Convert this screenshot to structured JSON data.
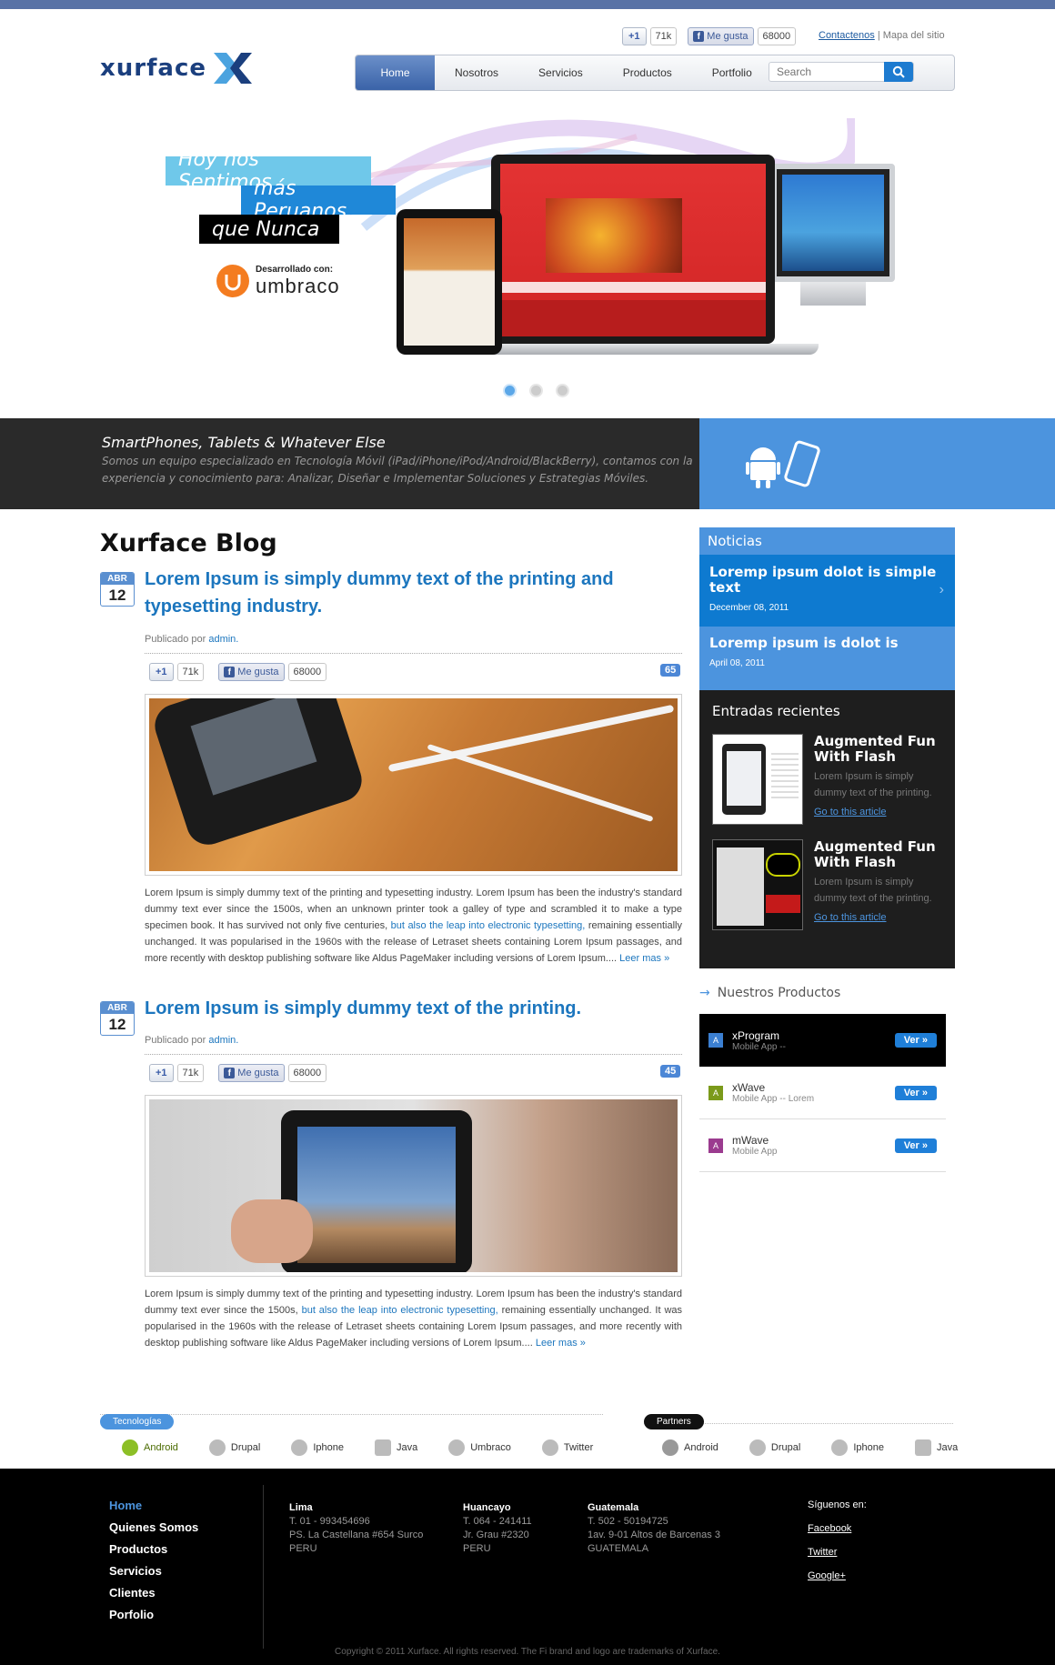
{
  "header": {
    "logo_text": "xurface",
    "gplus_label": "+1",
    "gplus_count": "71k",
    "fb_label": "Me gusta",
    "fb_count": "68000",
    "contact_link": "Contactenos",
    "sitemap_link": "Mapa del sitio",
    "search_placeholder": "Search"
  },
  "nav": {
    "items": [
      {
        "label": "Home"
      },
      {
        "label": "Nosotros"
      },
      {
        "label": "Servicios"
      },
      {
        "label": "Productos"
      },
      {
        "label": "Portfolio"
      }
    ]
  },
  "hero": {
    "line1": "Hoy nos Sentimos",
    "line2": "más Peruanos",
    "line3": "que Nunca",
    "dev_label": "Desarrollado con:",
    "dev_brand": "umbraco",
    "slides_total": 3,
    "slide_active": 1
  },
  "band": {
    "title": "SmartPhones, Tablets  & Whatever Else",
    "text": "Somos un equipo especializado en Tecnología Móvil (iPad/iPhone/iPod/Android/BlackBerry),  contamos con la experiencia y conocimiento para: Analizar, Diseñar e Implementar Soluciones y Estrategias Móviles."
  },
  "blog": {
    "title": "Xurface Blog",
    "posts": [
      {
        "month": "ABR",
        "day": "12",
        "title": "Lorem Ipsum is simply dummy text of the printing and typesetting industry.",
        "byline": "Publicado por",
        "author": "admin.",
        "gplus": "+1",
        "gcount": "71k",
        "fb": "Me gusta",
        "fbcount": "68000",
        "comments": "65",
        "p1": "Lorem Ipsum is simply dummy text of the printing and typesetting industry. Lorem Ipsum has been the industry's standard dummy text ever since the 1500s, when an unknown printer took a galley of type and scrambled it to make a type specimen book. It has survived not only five centuries,",
        "link": "but also the leap into electronic typesetting,",
        "p2": "remaining essentially unchanged. It was popularised in the 1960s with the release of Letraset sheets containing Lorem Ipsum passages, and more recently with desktop publishing software like Aldus PageMaker including versions of Lorem Ipsum....",
        "more": "Leer mas »"
      },
      {
        "month": "ABR",
        "day": "12",
        "title": "Lorem Ipsum is simply dummy text of the printing.",
        "byline": "Publicado por",
        "author": "admin.",
        "gplus": "+1",
        "gcount": "71k",
        "fb": "Me gusta",
        "fbcount": "68000",
        "comments": "45",
        "p1": "Lorem Ipsum is simply dummy text of the printing and typesetting industry. Lorem Ipsum has been the industry's standard dummy text ever since the 1500s,",
        "link": "but also the leap into electronic typesetting,",
        "p2": "remaining essentially unchanged. It was popularised in the 1960s with the release of Letraset sheets containing Lorem Ipsum passages, and more recently with desktop publishing software like Aldus PageMaker including versions of Lorem Ipsum....",
        "more": "Leer mas »"
      }
    ]
  },
  "sidebar": {
    "news_title": "Noticias",
    "news": [
      {
        "title": "Loremp ipsum dolot is simple text",
        "date": "December 08, 2011"
      },
      {
        "title": "Loremp ipsum is dolot is",
        "date": "April 08, 2011"
      }
    ],
    "recent_title": "Entradas recientes",
    "recent": [
      {
        "title": "Augmented Fun With Flash",
        "desc": "Lorem Ipsum is simply dummy text of the printing.",
        "link": "Go to this article"
      },
      {
        "title": "Augmented Fun With Flash",
        "desc": "Lorem Ipsum is simply dummy text of the printing.",
        "link": "Go to this article"
      }
    ],
    "products_title": "Nuestros Productos",
    "products": [
      {
        "name": "xProgram",
        "sub": "Mobile App --",
        "btn": "Ver »",
        "color": "#3b7fd1"
      },
      {
        "name": "xWave",
        "sub": "Mobile App -- Lorem",
        "btn": "Ver »",
        "color": "#7b9a1a"
      },
      {
        "name": "mWave",
        "sub": "Mobile App",
        "btn": "Ver »",
        "color": "#9b3b8f"
      }
    ]
  },
  "tech": {
    "label": "Tecnologías",
    "items": [
      "Android",
      "Drupal",
      "Iphone",
      "Java",
      "Umbraco",
      "Twitter"
    ]
  },
  "partners": {
    "label": "Partners",
    "items": [
      "Android",
      "Drupal",
      "Iphone",
      "Java"
    ]
  },
  "footer": {
    "nav": [
      "Home",
      "Quienes Somos",
      "Productos",
      "Servicios",
      "Clientes",
      "Porfolio"
    ],
    "offices": [
      {
        "city": "Lima",
        "l1": "T. 01 - 993454696",
        "l2": "PS. La Castellana #654 Surco",
        "l3": "PERU"
      },
      {
        "city": "Huancayo",
        "l1": "T. 064 - 241411",
        "l2": "Jr. Grau #2320",
        "l3": "PERU"
      },
      {
        "city": "Guatemala",
        "l1": "T. 502 - 50194725",
        "l2": "1av. 9-01 Altos de Barcenas 3",
        "l3": "GUATEMALA"
      }
    ],
    "follow": "Síguenos en:",
    "social": [
      "Facebook",
      "Twitter",
      "Google+"
    ],
    "copyright": "Copyright © 2011 Xurface. All rights reserved. The Fi brand and logo are trademarks of Xurface."
  }
}
